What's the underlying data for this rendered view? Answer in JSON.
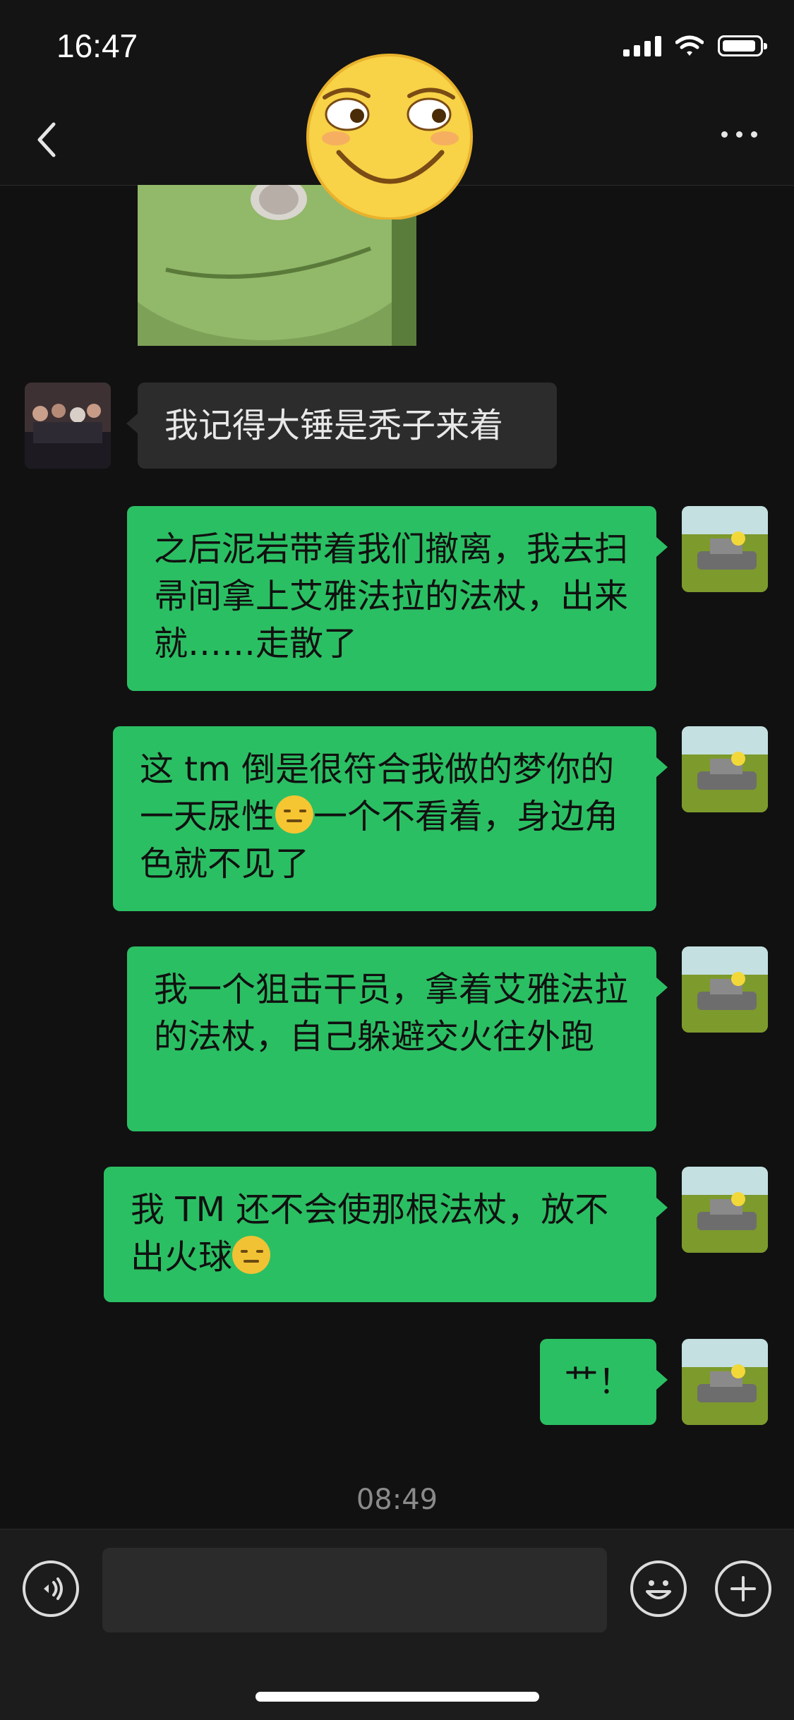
{
  "status_bar": {
    "time": "16:47"
  },
  "icons": {
    "back": "chevron-left-icon",
    "more": "more-dots-icon",
    "voice": "voice-icon",
    "emoji": "emoji-icon",
    "add": "plus-icon"
  },
  "messages": [
    {
      "side": "in",
      "text": "我记得大锤是秃子来着"
    },
    {
      "side": "out",
      "text": "之后泥岩带着我们撤离，我去扫帚间拿上艾雅法拉的法杖，出来就……走散了"
    },
    {
      "side": "out",
      "text_before": "这 tm 倒是很符合我做的梦你的一天尿性",
      "text_after": "一个不看着，身边角色就不见了"
    },
    {
      "side": "out",
      "text": "我一个狙击干员，拿着艾雅法拉的法杖，自己躲避交火往外跑"
    },
    {
      "side": "out",
      "text_before": "我 TM 还不会使那根法杖，放不出火球",
      "text_after": ""
    },
    {
      "side": "out",
      "text": "艹！"
    }
  ],
  "timestamp": "08:49",
  "colors": {
    "bubble_out": "#2bbf63",
    "bubble_in": "#2c2c2c",
    "background": "#111111"
  }
}
